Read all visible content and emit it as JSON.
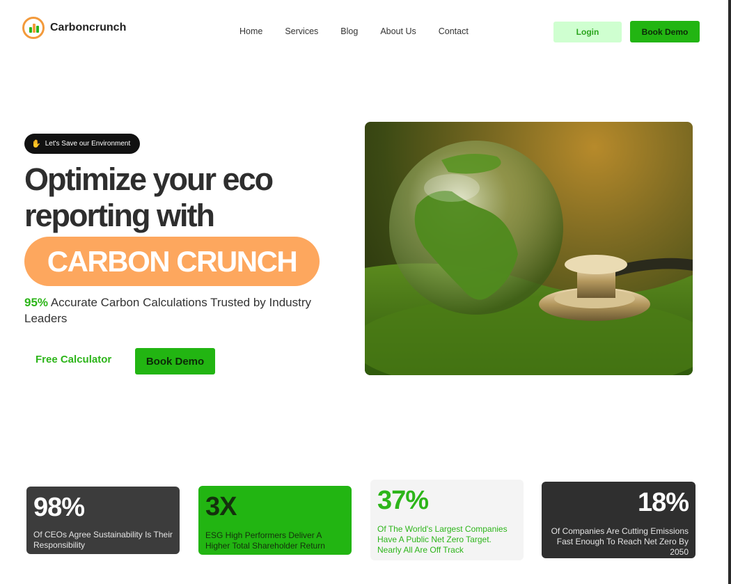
{
  "header": {
    "brand": "Carboncrunch",
    "nav": [
      "Home",
      "Services",
      "Blog",
      "About Us",
      "Contact"
    ],
    "login_label": "Login",
    "demo_label": "Book Demo"
  },
  "hero": {
    "pill_text": "Let's Save our Environment",
    "title_line1": "Optimize your eco",
    "title_line2": "reporting with",
    "highlight": "CARBON CRUNCH",
    "sub_pct": "95%",
    "sub_text": " Accurate Carbon Calculations Trusted by Industry Leaders",
    "calc_label": "Free Calculator",
    "demo_label": "Book Demo"
  },
  "stats": [
    {
      "value": "98%",
      "text": "Of CEOs Agree Sustainability Is Their Responsibility"
    },
    {
      "value": "3X",
      "text": "ESG High Performers Deliver A Higher Total Shareholder Return"
    },
    {
      "value": "37%",
      "text": "Of The World's Largest Companies Have A Public Net Zero Target. Nearly All Are Off Track"
    },
    {
      "value": "18%",
      "text": "Of Companies Are Cutting Emissions Fast Enough To Reach Net Zero By 2050"
    }
  ],
  "colors": {
    "accent_green": "#22b512",
    "accent_orange": "#fda75e",
    "dark_card": "#3c3c3c",
    "login_bg": "#cfffd0"
  },
  "icons": {
    "pill_icon": "hand-wave-icon",
    "logo_icon": "carbon-logo-icon"
  }
}
